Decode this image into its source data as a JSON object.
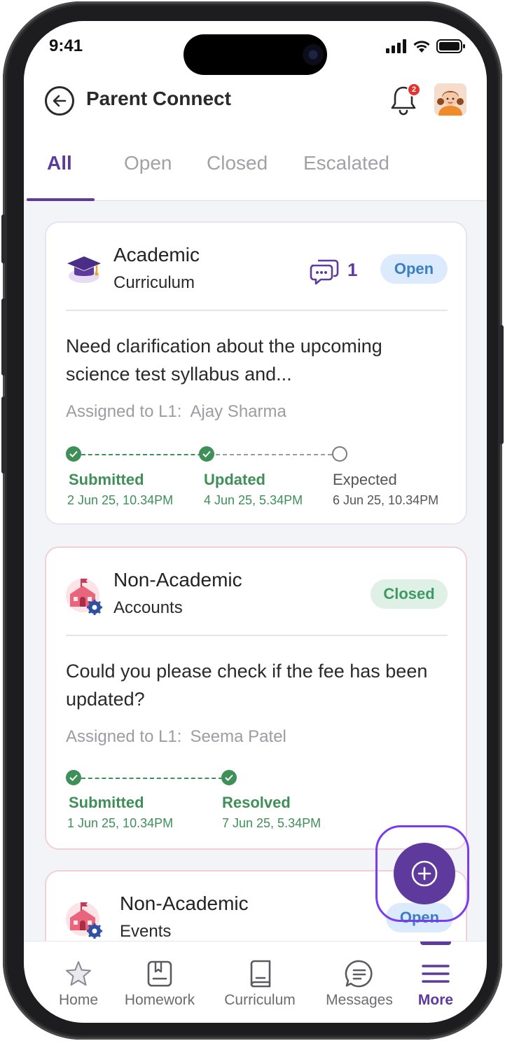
{
  "status_bar": {
    "time": "9:41"
  },
  "header": {
    "title": "Parent Connect",
    "notification_count": "2"
  },
  "tabs": [
    {
      "label": "All",
      "active": true
    },
    {
      "label": "Open"
    },
    {
      "label": "Closed"
    },
    {
      "label": "Escalated"
    }
  ],
  "tickets": [
    {
      "category": "Academic",
      "subcategory": "Curriculum",
      "comments": "1",
      "status": "Open",
      "message": "Need clarification about the upcoming science test syllabus and...",
      "assigned_label": "Assigned to L1:",
      "assigned_to": "Ajay Sharma",
      "timeline": [
        {
          "label": "Submitted",
          "date": "2 Jun 25, 10.34PM",
          "done": true
        },
        {
          "label": "Updated",
          "date": "4 Jun 25, 5.34PM",
          "done": true
        },
        {
          "label": "Expected",
          "date": "6 Jun 25, 10.34PM",
          "done": false
        }
      ]
    },
    {
      "category": "Non-Academic",
      "subcategory": "Accounts",
      "status": "Closed",
      "message": "Could you please check if the fee has been updated?",
      "assigned_label": "Assigned to L1:",
      "assigned_to": "Seema Patel",
      "timeline": [
        {
          "label": "Submitted",
          "date": "1 Jun 25, 10.34PM",
          "done": true
        },
        {
          "label": "Resolved",
          "date": "7 Jun 25, 5.34PM",
          "done": true
        }
      ]
    },
    {
      "category": "Non-Academic",
      "subcategory": "Events",
      "status": "Open"
    }
  ],
  "bottom_nav": [
    {
      "label": "Home",
      "icon": "star-icon"
    },
    {
      "label": "Homework",
      "icon": "homework-icon"
    },
    {
      "label": "Curriculum",
      "icon": "book-icon"
    },
    {
      "label": "Messages",
      "icon": "chat-icon"
    },
    {
      "label": "More",
      "icon": "menu-icon",
      "active": true
    }
  ],
  "colors": {
    "primary": "#5d3a9b",
    "open_chip_bg": "#dbeafc",
    "open_chip_text": "#3a7fc4",
    "closed_chip_bg": "#dff1e6",
    "closed_chip_text": "#3e9a62",
    "success": "#3f8f59",
    "fab_highlight": "#7a3cf0"
  }
}
